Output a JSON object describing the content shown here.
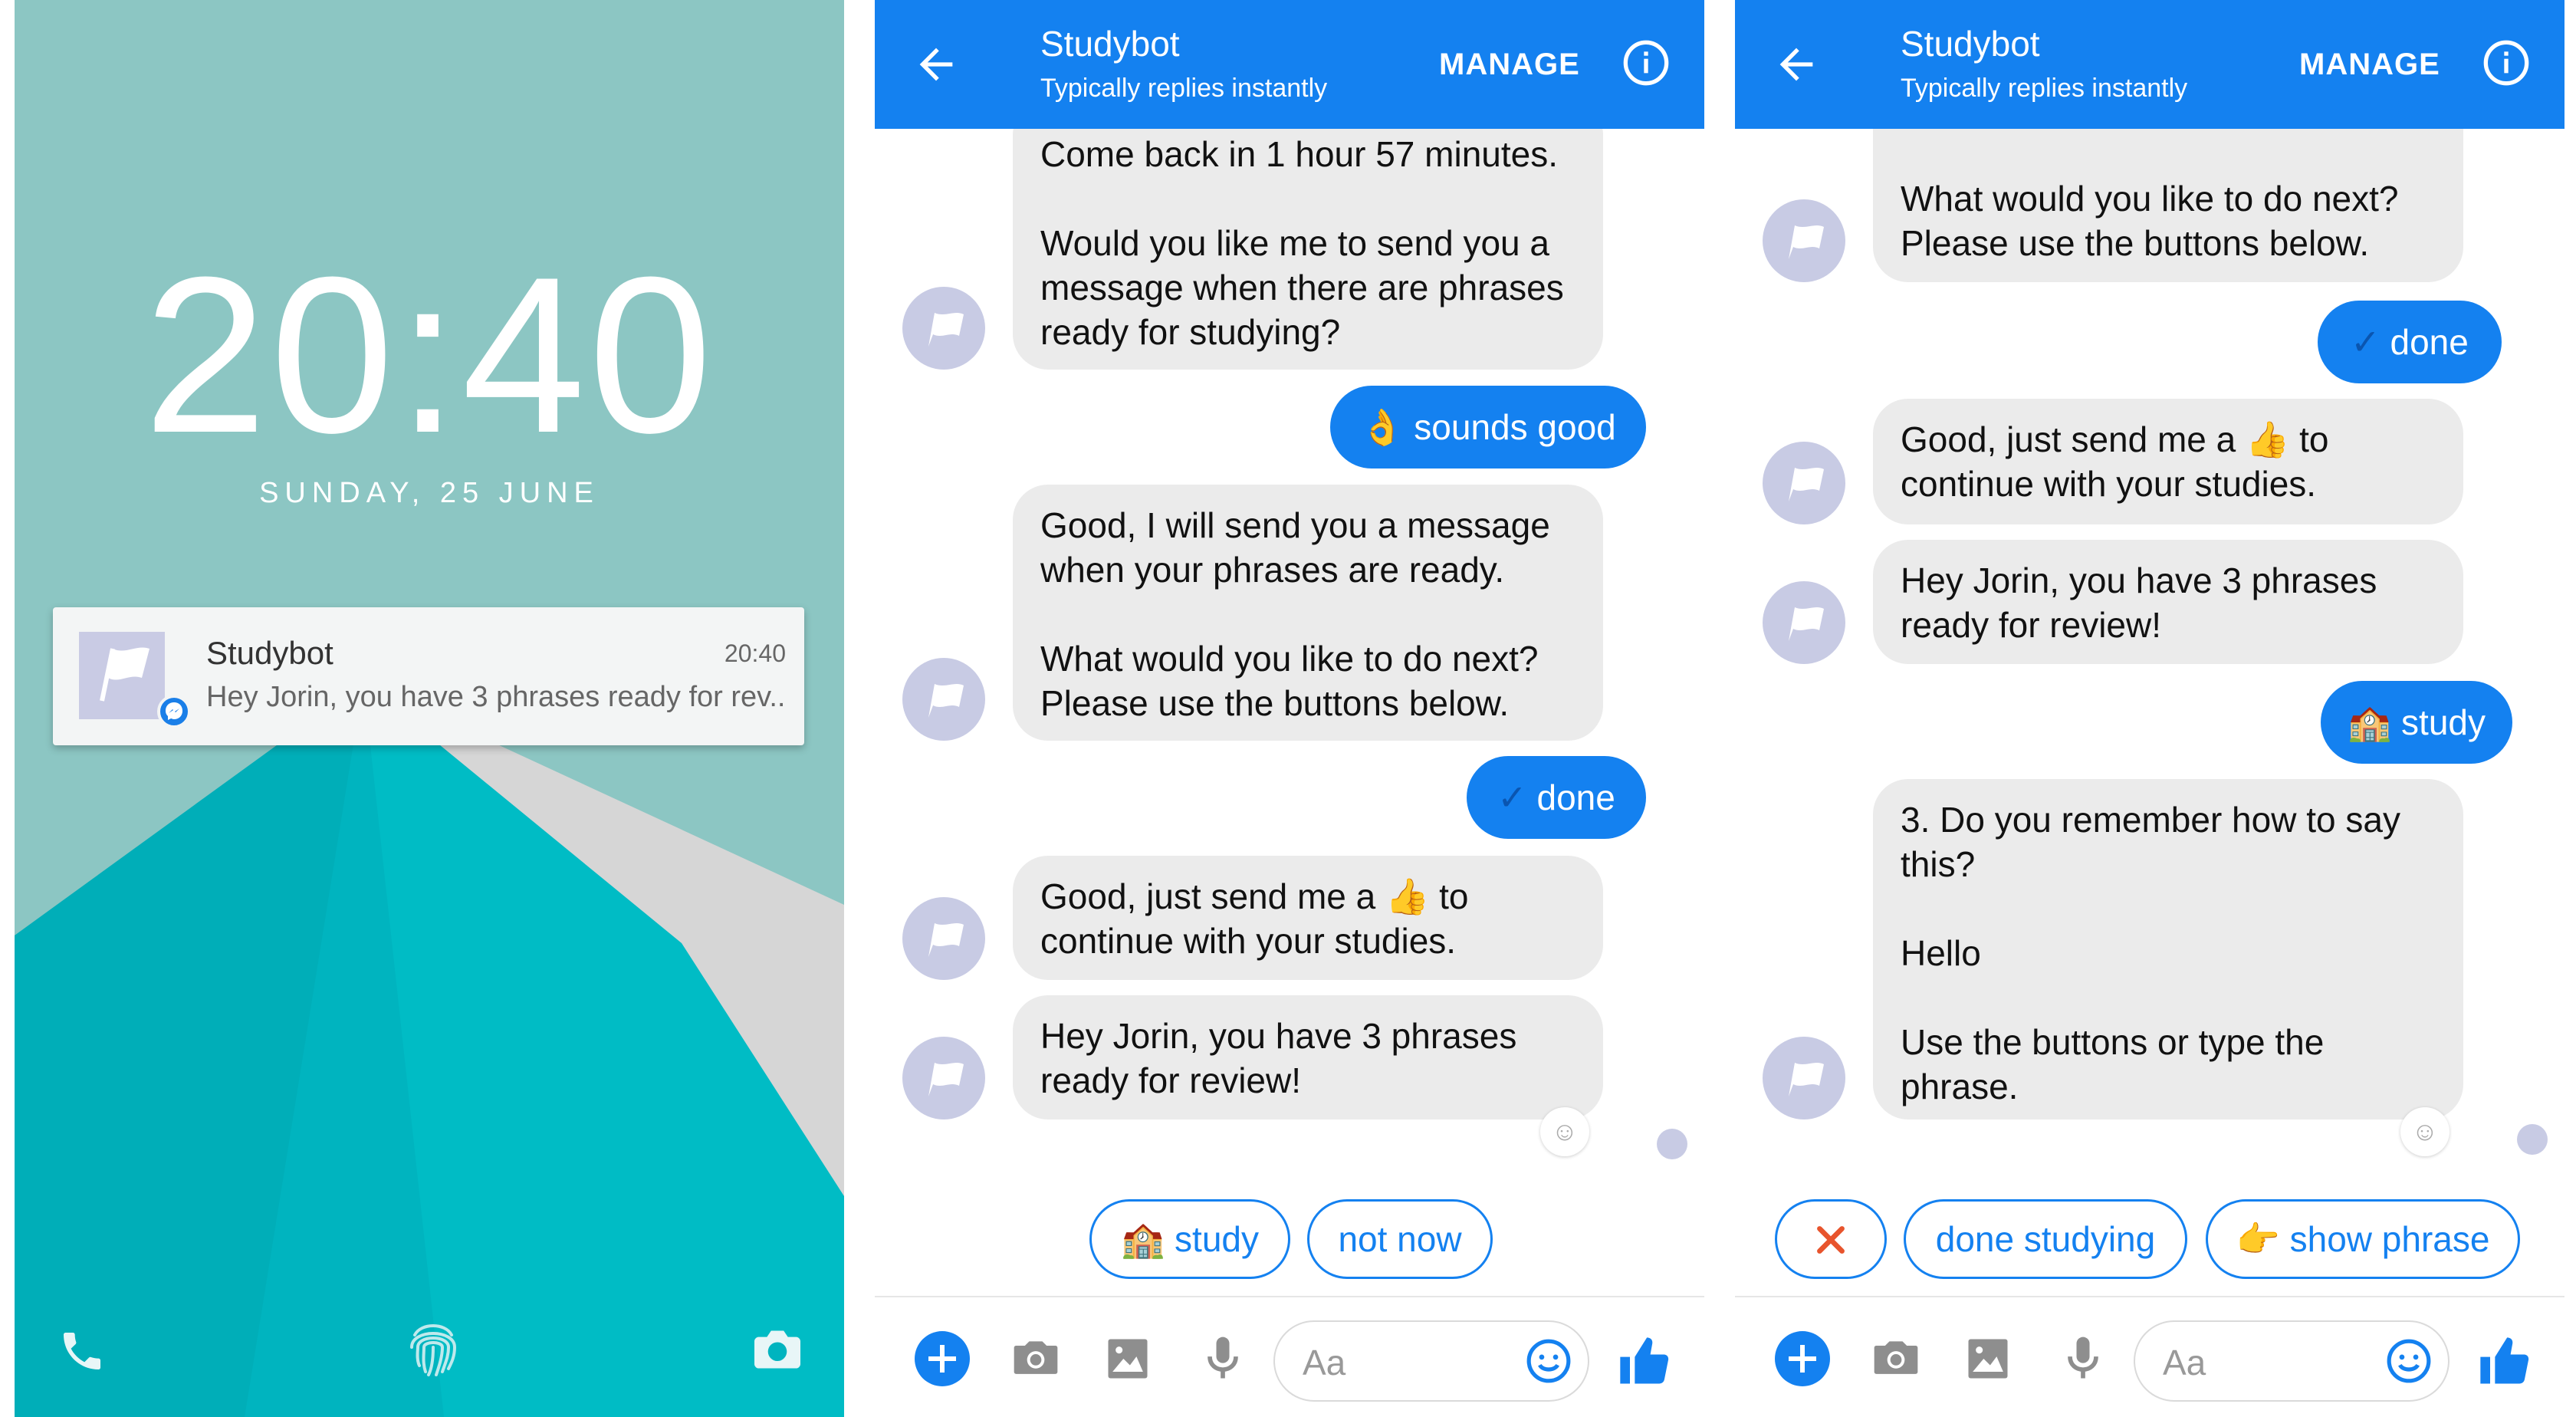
{
  "lockscreen": {
    "time": "20:40",
    "date": "SUNDAY, 25 JUNE",
    "notification": {
      "title": "Studybot",
      "time": "20:40",
      "text": "Hey Jorin, you have 3 phrases ready for rev.."
    }
  },
  "header": {
    "title": "Studybot",
    "subtitle": "Typically replies instantly",
    "manage": "MANAGE"
  },
  "chat1": {
    "msg1_line1": "Come back in 1 hour 57 minutes.",
    "msg1_line2": "Would you like me to send you a",
    "msg1_line3": "message when there are phrases",
    "msg1_line4": "ready for studying?",
    "reply1": "sounds good",
    "msg2_line1": "Good, I will send you a message",
    "msg2_line2": "when your phrases are ready.",
    "msg2_line3": "What would you like to do next?",
    "msg2_line4": "Please use the buttons below.",
    "reply2": "done",
    "msg3_line1a": "Good, just send me a",
    "msg3_line1b": "to",
    "msg3_line2": "continue with your studies.",
    "msg4_line1": "Hey Jorin, you have 3 phrases",
    "msg4_line2": "ready for review!",
    "quick1": "study",
    "quick2": "not now"
  },
  "chat2": {
    "msg1_line1": "What would you like to do next?",
    "msg1_line2": "Please use the buttons below.",
    "reply1": "done",
    "msg2_line1a": "Good, just send me a",
    "msg2_line1b": "to",
    "msg2_line2": "continue with your studies.",
    "msg3_line1": "Hey Jorin, you have 3 phrases",
    "msg3_line2": "ready for review!",
    "reply2": "study",
    "msg4_line1": "3. Do you remember how to say",
    "msg4_line2": "this?",
    "msg4_line3": "Hello",
    "msg4_line4": "Use the buttons or type the",
    "msg4_line5": "phrase.",
    "quick1": "done studying",
    "quick2": "show phrase"
  },
  "composer": {
    "placeholder": "Aa"
  },
  "colors": {
    "messenger_blue": "#1481f0",
    "bot_bubble": "#ebebeb",
    "lockscreen_teal": "#8cc6c3",
    "close_red": "#e8542d"
  },
  "icons": [
    "back-arrow-icon",
    "info-icon",
    "plus-icon",
    "camera-icon",
    "image-icon",
    "microphone-icon",
    "smiley-icon",
    "thumbs-up-icon",
    "phone-icon",
    "fingerprint-icon",
    "flag-icon",
    "messenger-icon",
    "ok-hand-emoji",
    "check-mark-emoji",
    "thumbs-up-emoji",
    "school-emoji",
    "pointing-hand-emoji",
    "close-x-icon"
  ]
}
